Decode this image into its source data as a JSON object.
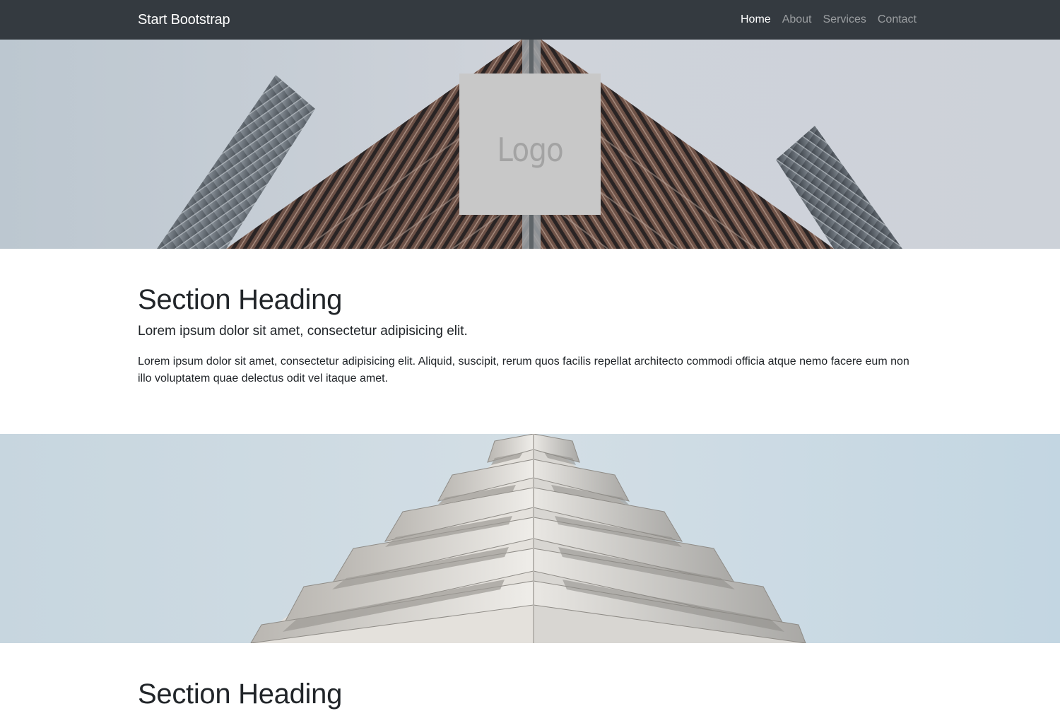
{
  "navbar": {
    "brand": "Start Bootstrap",
    "links": [
      {
        "label": "Home",
        "active": true
      },
      {
        "label": "About",
        "active": false
      },
      {
        "label": "Services",
        "active": false
      },
      {
        "label": "Contact",
        "active": false
      }
    ]
  },
  "hero": {
    "logo_text": "Logo"
  },
  "sections": [
    {
      "heading": "Section Heading",
      "lead": "Lorem ipsum dolor sit amet, consectetur adipisicing elit.",
      "body": "Lorem ipsum dolor sit amet, consectetur adipisicing elit. Aliquid, suscipit, rerum quos facilis repellat architecto commodi officia atque nemo facere eum non illo voluptatem quae delectus odit vel itaque amet."
    },
    {
      "heading": "Section Heading"
    }
  ],
  "colors": {
    "navbar_bg": "#343a40",
    "brand_text": "#ffffff",
    "nav_inactive": "rgba(255,255,255,0.5)",
    "text_dark": "#212529",
    "logo_placeholder": "#c8c8c8"
  }
}
